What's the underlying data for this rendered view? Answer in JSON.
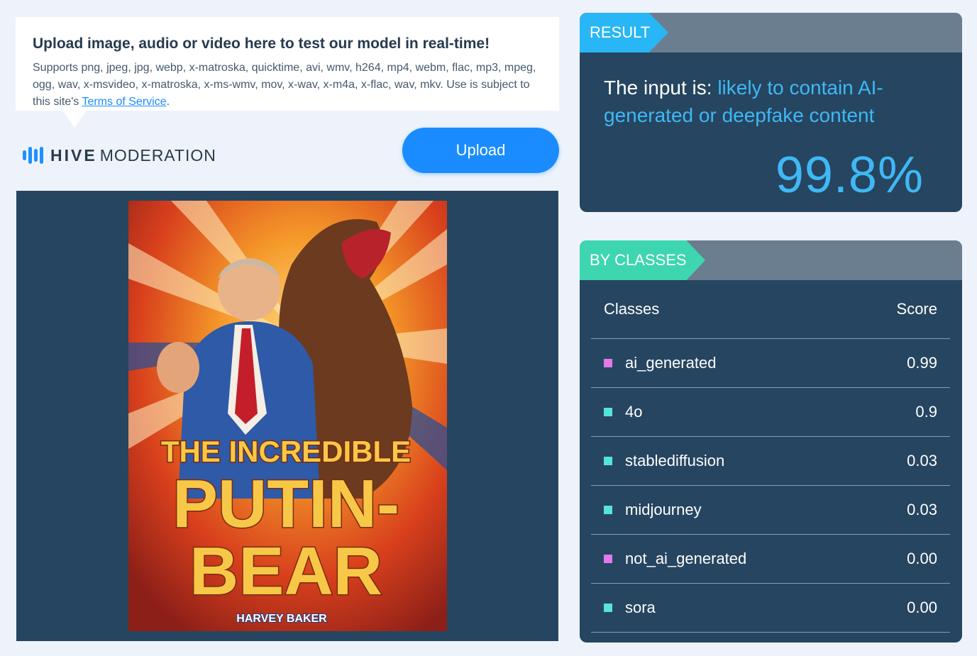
{
  "upload_info": {
    "title": "Upload image, audio or video here to test our model in real-time!",
    "description": "Supports png, jpeg, jpg, webp, x-matroska, quicktime, avi, wmv, h264, mp4, webm, flac, mp3, mpeg, ogg, wav, x-msvideo, x-matroska, x-ms-wmv, mov, x-wav, x-m4a, x-flac, wav, mkv. Use is subject to this site's ",
    "tos_link": "Terms of Service",
    "tos_suffix": "."
  },
  "logo": {
    "brand_bold": "HIVE",
    "brand_light": "MODERATION",
    "icon": "hive-logo-icon"
  },
  "upload_button": {
    "label": "Upload"
  },
  "preview": {
    "book_title_top": "THE INCREDIBLE",
    "book_title_main1": "PUTIN-",
    "book_title_main2": "BEAR",
    "book_author": "HARVEY BAKER"
  },
  "result": {
    "tag": "RESULT",
    "prefix": "The input is: ",
    "verdict": "likely to contain AI-generated or deepfake content",
    "percentage": "99.8%"
  },
  "classes": {
    "tag": "BY CLASSES",
    "header_class": "Classes",
    "header_score": "Score",
    "rows": [
      {
        "name": "ai_generated",
        "score": "0.99",
        "color": "#e07be8"
      },
      {
        "name": "4o",
        "score": "0.9",
        "color": "#56e3e0"
      },
      {
        "name": "stablediffusion",
        "score": "0.03",
        "color": "#56e3e0"
      },
      {
        "name": "midjourney",
        "score": "0.03",
        "color": "#56e3e0"
      },
      {
        "name": "not_ai_generated",
        "score": "0.00",
        "color": "#e07be8"
      },
      {
        "name": "sora",
        "score": "0.00",
        "color": "#56e3e0"
      }
    ]
  },
  "colors": {
    "accent": "#1a8cff",
    "result_blue": "#3fb8f5",
    "panel": "#264560",
    "classes_tag": "#3ed6b0"
  }
}
